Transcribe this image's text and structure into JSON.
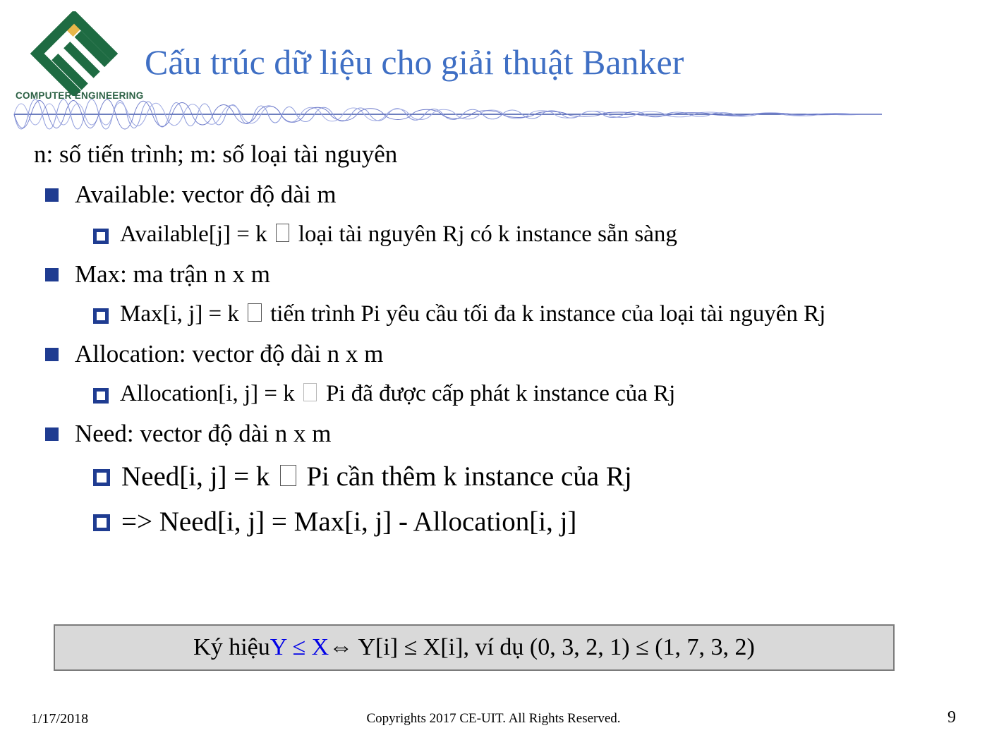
{
  "logo": {
    "caption": "COMPUTER ENGINEERING",
    "green": "#1E6B42",
    "accent": "#E8B74A"
  },
  "title": "Cấu trúc dữ liệu cho giải thuật Banker",
  "title_color": "#3F6FC4",
  "body": {
    "intro": "n: số tiến trình; m: số loại tài nguyên",
    "items": [
      {
        "level": 1,
        "text": "Available: vector độ dài m"
      },
      {
        "level": 2,
        "pre": "Available[j] = k",
        "glyph": "tofu",
        "post": "loại tài nguyên Rj có k instance sẵn sàng"
      },
      {
        "level": 1,
        "text": "Max: ma trận n x m"
      },
      {
        "level": 2,
        "pre": "Max[i, j] = k",
        "glyph": "tofu",
        "post": "tiến trình Pi yêu cầu tối đa k instance của loại tài nguyên Rj"
      },
      {
        "level": 1,
        "text": "Allocation: vector độ dài n x m"
      },
      {
        "level": 2,
        "pre": "Allocation[i, j] = k",
        "glyph": "tofu-faint",
        "post": "Pi đã được cấp phát k instance của Rj"
      },
      {
        "level": 1,
        "text": "Need: vector độ dài n x m"
      },
      {
        "level": 2,
        "big": true,
        "pre": "Need[i, j] = k",
        "glyph": "tofu",
        "post": "Pi cần thêm k instance của Rj"
      },
      {
        "level": 2,
        "big": true,
        "pre": "=> Need[i, j] = Max[i, j] - Allocation[i, j]",
        "glyph": "",
        "post": ""
      }
    ]
  },
  "callout": {
    "lead": "Ký hiệu ",
    "highlight": "Y ≤ X",
    "rest": " ⇔ Y[i] ≤ X[i], ví dụ (0, 3, 2, 1) ≤ (1, 7, 3, 2)",
    "highlight_color": "#0000E6",
    "background": "#D9D9D9"
  },
  "footer": {
    "date": "1/17/2018",
    "copyright": "Copyrights 2017 CE-UIT. All Rights Reserved.",
    "page": "9"
  }
}
